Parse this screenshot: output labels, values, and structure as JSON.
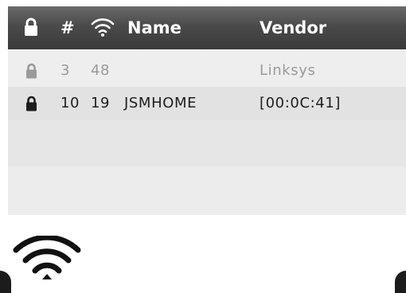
{
  "table": {
    "columns": {
      "lock_icon": "lock-icon",
      "number": "#",
      "signal_icon": "wifi-signal-icon",
      "name": "Name",
      "vendor": "Vendor"
    },
    "rows": [
      {
        "locked": true,
        "number": "3",
        "signal": "48",
        "name": "",
        "vendor": "Linksys"
      },
      {
        "locked": true,
        "number": "10",
        "signal": "19",
        "name": "JSMHOME",
        "vendor": "[00:0C:41]"
      }
    ]
  },
  "colors": {
    "header_bg": "#4a4a4a",
    "header_text": "#ffffff",
    "row_dim_text": "#9a9a9a",
    "row_selected_text": "#1e1e1e",
    "table_bg": "#eeeeee"
  },
  "footer": {
    "icon": "wifi-icon"
  }
}
